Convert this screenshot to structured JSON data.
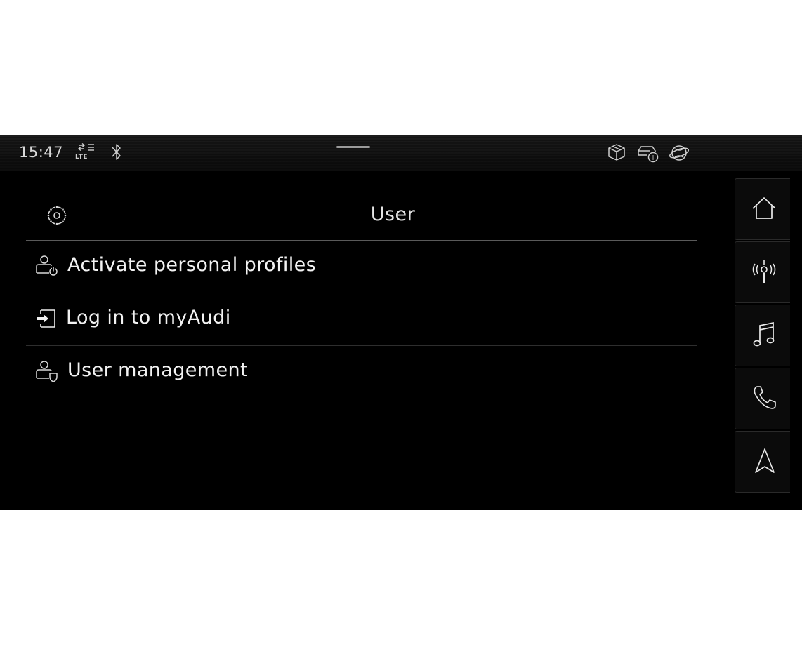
{
  "statusbar": {
    "time": "15:47",
    "network_label": "LTE",
    "icons": [
      "lte-signal-icon",
      "bluetooth-icon",
      "package-icon",
      "car-info-icon",
      "online-globe-icon"
    ]
  },
  "header": {
    "title": "User",
    "settings_icon": "gear-icon"
  },
  "menu": {
    "items": [
      {
        "label": "Activate personal profiles",
        "icon": "user-power-icon"
      },
      {
        "label": "Log in to myAudi",
        "icon": "login-icon"
      },
      {
        "label": "User management",
        "icon": "user-shield-icon"
      }
    ]
  },
  "rail": {
    "buttons": [
      "home-icon",
      "radio-icon",
      "music-icon",
      "phone-icon",
      "navigation-icon"
    ]
  },
  "colors": {
    "background": "#000000",
    "text": "#f2f2f2",
    "divider": "#5a5a5a"
  }
}
